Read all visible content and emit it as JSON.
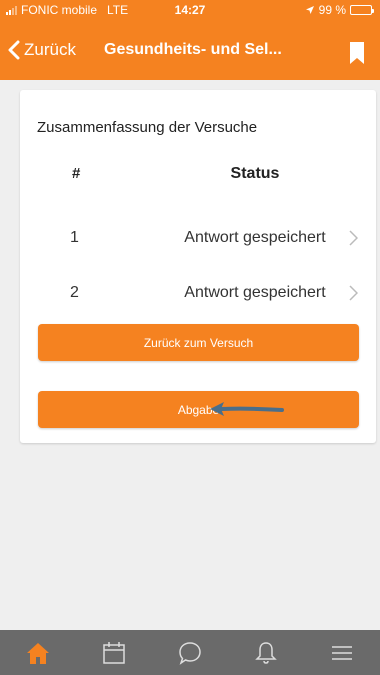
{
  "status_bar": {
    "carrier": "FONIC mobile",
    "network": "LTE",
    "time": "14:27",
    "battery": "99 %",
    "battery_level": 0.99
  },
  "nav": {
    "back_label": "Zurück",
    "title": "Gesundheits- und Sel...",
    "bookmark_icon": "bookmark-icon"
  },
  "summary": {
    "title": "Zusammenfassung der Versuche",
    "columns": [
      "#",
      "Status"
    ],
    "rows": [
      {
        "num": "1",
        "status": "Antwort gespeichert"
      },
      {
        "num": "2",
        "status": "Antwort gespeichert"
      }
    ],
    "back_button": "Zurück zum Versuch",
    "submit_button": "Abgabe"
  },
  "tabs": [
    {
      "icon": "home-icon",
      "active": true
    },
    {
      "icon": "calendar-icon",
      "active": false
    },
    {
      "icon": "chat-icon",
      "active": false
    },
    {
      "icon": "bell-icon",
      "active": false
    },
    {
      "icon": "menu-icon",
      "active": false
    }
  ],
  "colors": {
    "accent": "#f58220",
    "tabbar": "#6a6a6a",
    "background": "#efefef",
    "arrow": "#4a6e8a"
  }
}
